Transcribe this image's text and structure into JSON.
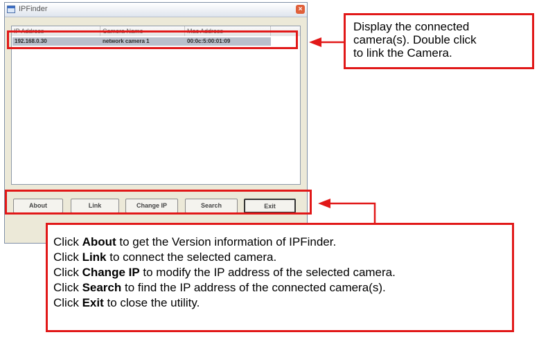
{
  "window": {
    "title": "IPFinder",
    "close_glyph": "×",
    "columns": [
      "IP Address",
      "Camera Name",
      "Mac Address"
    ],
    "rows": [
      [
        "192.168.0.30",
        "network camera 1",
        "00:0c:5:00:01:09"
      ]
    ],
    "buttons": {
      "about": "About",
      "link": "Link",
      "change_ip": "Change IP",
      "search": "Search",
      "exit": "Exit"
    }
  },
  "annotations": {
    "top_note": [
      "Display the connected",
      "camera(s). Double click",
      "to link the Camera."
    ],
    "bottom_note": [
      {
        "pre": "Click ",
        "bold": "About",
        "post": " to get the Version information of IPFinder."
      },
      {
        "pre": "Click ",
        "bold": "Link",
        "post": " to connect the selected camera."
      },
      {
        "pre": "Click ",
        "bold": "Change IP",
        "post": " to modify the IP address of the selected camera."
      },
      {
        "pre": "Click ",
        "bold": "Search",
        "post": " to find the IP address of the connected camera(s)."
      },
      {
        "pre": "Click ",
        "bold": "Exit",
        "post": " to close the utility."
      }
    ]
  },
  "colors": {
    "annotation_red": "#e11818",
    "selected_row": "#b9bfcb"
  }
}
